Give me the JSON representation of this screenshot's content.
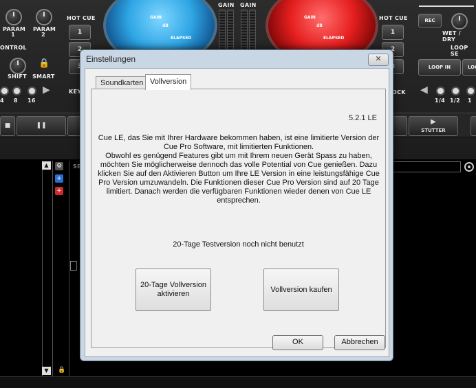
{
  "background": {
    "left_deck": {
      "param1_label": "PARAM\n1",
      "param2_label": "PARAM\n2",
      "control_label": "ONTROL",
      "shift_label": "SHIFT",
      "smart_label": "SMART",
      "beat_labels": [
        "4",
        "8",
        "16"
      ],
      "hot_cue_label": "HOT CUE",
      "hot_cue_buttons": [
        "1",
        "2",
        "3"
      ],
      "key_label": "KEY"
    },
    "platter_left": {
      "gain": "GAIN",
      "db": "dB",
      "elapsed": "ELAPSED"
    },
    "platter_right": {
      "gain": "GAIN",
      "db": "dB",
      "elapsed": "ELAPSED"
    },
    "mixer": {
      "gain_left": "GAIN",
      "gain_right": "GAIN"
    },
    "right_deck": {
      "hot_cue_label": "HOT CUE",
      "hot_cue_buttons": [
        "1",
        "2",
        "3"
      ],
      "rec_label": "REC",
      "wet_dry_label": "WET / DRY",
      "loop_section_label": "LOOP SE",
      "loop_in_label": "LOOP IN",
      "loop_out_label": "LOO",
      "lock_label": "OCK",
      "loop_sizes": [
        "1/4",
        "1/2",
        "1"
      ],
      "stutter_label": "STUTTER"
    },
    "browser": {
      "sidebar_header": "SE"
    }
  },
  "dialog": {
    "title": "Einstellungen",
    "close_glyph": "✕",
    "tabs": [
      {
        "label": "Soundkarten",
        "active": false
      },
      {
        "label": "Vollversion",
        "active": true
      }
    ],
    "version": "5.2.1 LE",
    "description": [
      "Cue LE, das Sie mit Ihrer Hardware bekommen haben, ist eine limitierte Version der Cue Pro Software, mit limitierten Funktionen.",
      "Obwohl es genügend Features gibt um mit Ihrem neuen Gerät Spass zu haben, möchten Sie möglicherweise dennoch das volle Potential von Cue genießen. Dazu klicken Sie auf den Aktivieren Button um Ihre LE Version in eine leistungsfähige Cue Pro Version umzuwandeln. Die Funktionen dieser Cue Pro Version sind auf 20 Tage limitiert. Danach werden die verfügbaren Funktionen wieder denen von Cue LE entsprechen."
    ],
    "trial_status": "20-Tage Testversion noch nicht benutzt",
    "trial_button": "20-Tage Vollversion aktivieren",
    "buy_button": "Vollversion kaufen",
    "ok_button": "OK",
    "cancel_button": "Abbrechen"
  }
}
